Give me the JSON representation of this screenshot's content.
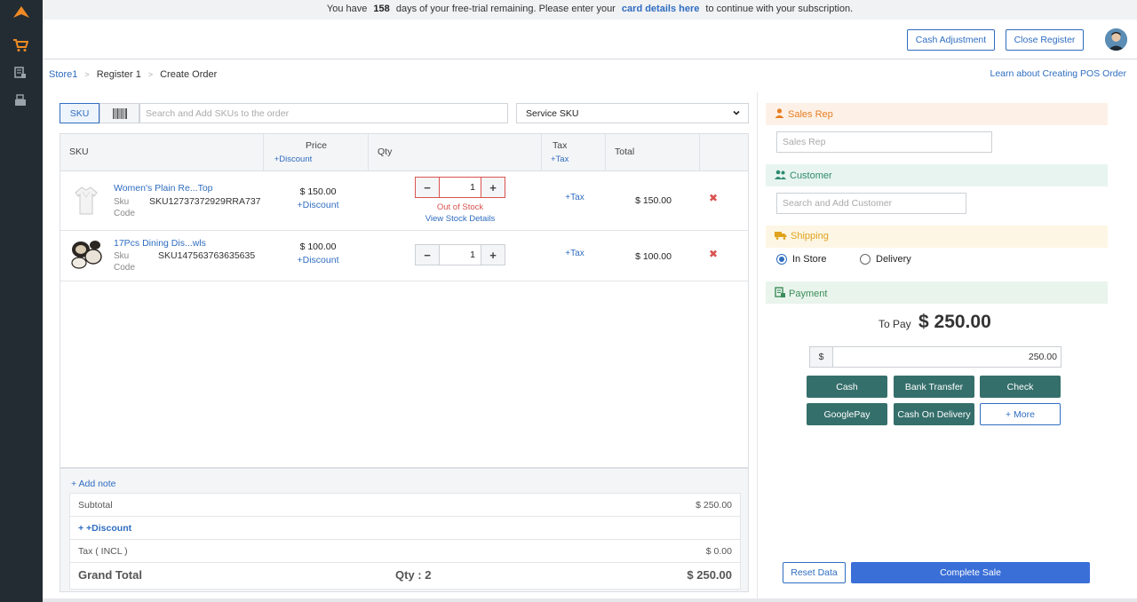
{
  "trial": {
    "before": "You have",
    "days": "158",
    "middle": "days of your free-trial remaining. Please enter your",
    "link": "card details here",
    "after": "to continue with your subscription."
  },
  "header": {
    "cash_adjustment": "Cash Adjustment",
    "close_register": "Close Register"
  },
  "breadcrumb": {
    "store": "Store1",
    "register": "Register 1",
    "current": "Create Order",
    "sep": ">"
  },
  "learn_link": "Learn about Creating POS Order",
  "search": {
    "sku_toggle": "SKU",
    "placeholder": "Search and Add SKUs to the order",
    "service_sku": "Service SKU"
  },
  "table": {
    "headers": {
      "sku": "SKU",
      "price": "Price",
      "price_sub": "+Discount",
      "qty": "Qty",
      "tax": "Tax",
      "tax_sub": "+Tax",
      "total": "Total"
    },
    "rows": [
      {
        "name": "Women's Plain Re...Top",
        "sku_label": "Sku Code",
        "sku_label_1": "Sku",
        "sku_label_2": "Code",
        "sku_code": "SKU12737372929RRA737",
        "price": "$ 150.00",
        "discount": "+Discount",
        "qty": "1",
        "out_of_stock": "Out of Stock",
        "stock_details": "View Stock Details",
        "tax": "+Tax",
        "total": "$ 150.00",
        "remove": "✖"
      },
      {
        "name": "17Pcs Dining Dis...wls",
        "sku_label_1": "Sku",
        "sku_label_2": "Code",
        "sku_code": "SKU147563763635635",
        "price": "$ 100.00",
        "discount": "+Discount",
        "qty": "1",
        "tax": "+Tax",
        "total": "$ 100.00",
        "remove": "✖"
      }
    ]
  },
  "summary": {
    "add_note": "+ Add note",
    "subtotal_label": "Subtotal",
    "subtotal_value": "$ 250.00",
    "discount_label": "+ +Discount",
    "tax_label": "Tax ( INCL )",
    "tax_value": "$ 0.00",
    "grand_label": "Grand Total",
    "qty_label": "Qty : 2",
    "grand_value": "$ 250.00"
  },
  "side": {
    "sales_rep_title": "Sales Rep",
    "sales_rep_placeholder": "Sales Rep",
    "customer_title": "Customer",
    "customer_placeholder": "Search and Add Customer",
    "shipping_title": "Shipping",
    "in_store": "In Store",
    "delivery": "Delivery",
    "payment_title": "Payment",
    "to_pay_label": "To Pay",
    "to_pay_value": "$ 250.00",
    "currency": "$",
    "amount": "250.00",
    "methods": [
      "Cash",
      "Bank Transfer",
      "Check",
      "GooglePay",
      "Cash On Delivery",
      "+ More"
    ],
    "reset": "Reset Data",
    "complete": "Complete Sale"
  },
  "colors": {
    "sidebar": "#232c33",
    "accent": "#2f6dc0",
    "cart_icon": "#f08a24",
    "pay_button": "#356f6b",
    "complete_button": "#3a6fd8",
    "sales_rep_bg": "#fdf1e7",
    "customer_bg": "#e8f4ef",
    "shipping_bg": "#fdf6e4",
    "payment_bg": "#e9f4ec"
  }
}
